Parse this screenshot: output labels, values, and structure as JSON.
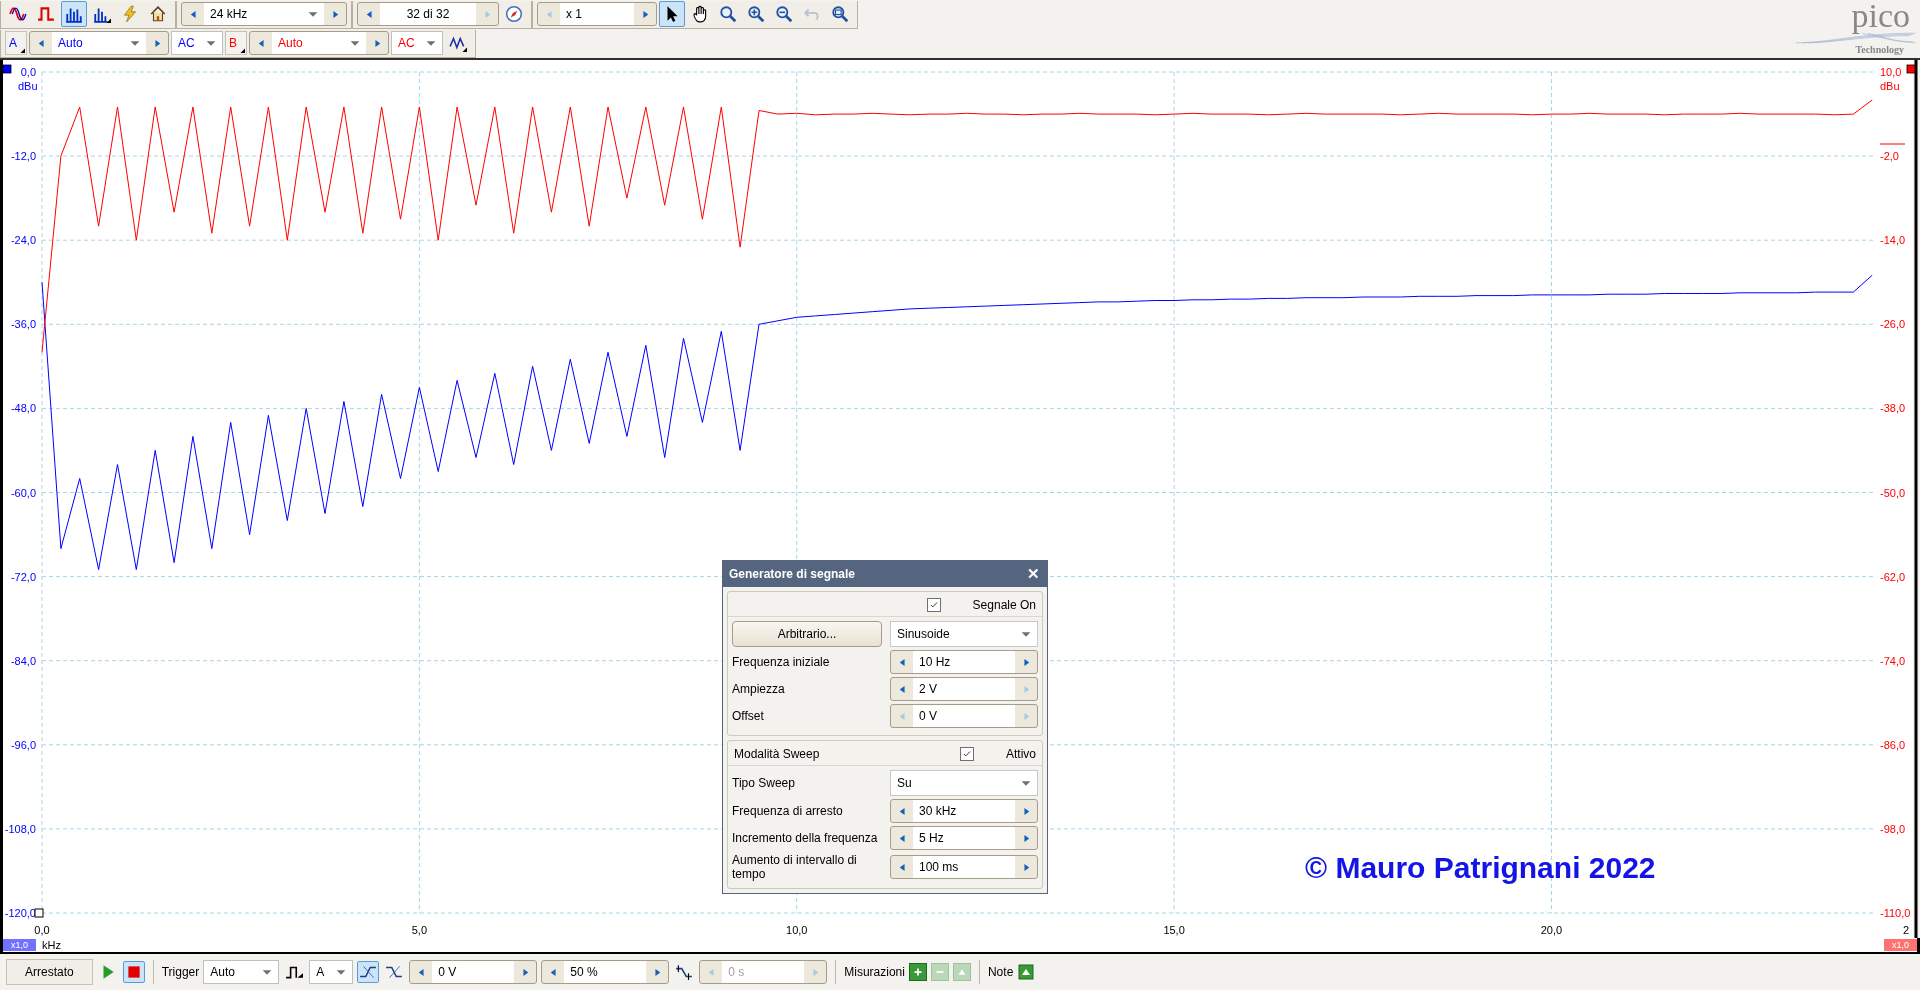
{
  "toolbar": {
    "view_modes": [
      {
        "selected": false
      },
      {
        "selected": false
      },
      {
        "selected": true
      },
      {
        "selected": false
      }
    ],
    "frequency_range": {
      "value": "24 kHz",
      "prev_disabled": false,
      "next_disabled": false
    },
    "capture": {
      "value": "32 di 32",
      "prev_disabled": false,
      "next_disabled": true
    },
    "zoom": {
      "value": "x 1",
      "prev_disabled": true,
      "next_disabled": false
    },
    "tools": [
      {
        "selected": true
      },
      {
        "selected": false
      },
      {
        "selected": false
      },
      {
        "selected": false
      },
      {
        "selected": false
      }
    ],
    "undo_disabled": true
  },
  "channels": [
    {
      "name": "A",
      "color": "#0000ff",
      "range": "Auto",
      "coupling": "AC",
      "prev_disabled": false,
      "next_disabled": false
    },
    {
      "name": "B",
      "color": "#ff0000",
      "range": "Auto",
      "coupling": "AC",
      "prev_disabled": false,
      "next_disabled": false
    }
  ],
  "logo": {
    "name": "pico",
    "tagline": "Technology"
  },
  "plot": {
    "chart_data": {
      "type": "line",
      "grid": true,
      "xlabel": "kHz",
      "ylabel": "dBu",
      "y2label": "dBu",
      "x": [
        0,
        0.25,
        0.5,
        0.75,
        1,
        1.25,
        1.5,
        1.75,
        2,
        2.25,
        2.5,
        2.75,
        3,
        3.25,
        3.5,
        3.75,
        4,
        4.25,
        4.5,
        4.75,
        5,
        5.25,
        5.5,
        5.75,
        6,
        6.25,
        6.5,
        6.75,
        7,
        7.25,
        7.5,
        7.75,
        8,
        8.25,
        8.5,
        8.75,
        9,
        9.25,
        9.5,
        9.75,
        10,
        10.25,
        10.5,
        10.75,
        11,
        11.25,
        11.5,
        11.75,
        12,
        12.25,
        12.5,
        12.75,
        13,
        13.25,
        13.5,
        13.75,
        14,
        14.25,
        14.5,
        14.75,
        15,
        15.25,
        15.5,
        15.75,
        16,
        16.25,
        16.5,
        16.75,
        17,
        17.25,
        17.5,
        17.75,
        18,
        18.25,
        18.5,
        18.75,
        19,
        19.25,
        19.5,
        19.75,
        20,
        20.25,
        20.5,
        20.75,
        21,
        21.25,
        21.5,
        21.75,
        22,
        22.25,
        22.5,
        22.75,
        23,
        23.25,
        23.5,
        23.75,
        24,
        24.25
      ],
      "xlim": [
        0,
        24.3
      ],
      "ylim": [
        -120,
        0
      ],
      "y2lim": [
        -110,
        10
      ],
      "xticks": [
        {
          "value": 0,
          "label": "0,0"
        },
        {
          "value": 5,
          "label": "5,0"
        },
        {
          "value": 10,
          "label": "10,0"
        },
        {
          "value": 15,
          "label": "15,0"
        },
        {
          "value": 20,
          "label": "20,0"
        }
      ],
      "yticks": [
        {
          "value": 0,
          "label": "0,0"
        },
        {
          "value": -12,
          "label": "-12,0"
        },
        {
          "value": -24,
          "label": "-24,0"
        },
        {
          "value": -36,
          "label": "-36,0"
        },
        {
          "value": -48,
          "label": "-48,0"
        },
        {
          "value": -60,
          "label": "-60,0"
        },
        {
          "value": -72,
          "label": "-72,0"
        },
        {
          "value": -84,
          "label": "-84,0"
        },
        {
          "value": -96,
          "label": "-96,0"
        },
        {
          "value": -108,
          "label": "-108,0"
        },
        {
          "value": -120,
          "label": "-120,0"
        }
      ],
      "y2ticks": [
        {
          "value": 10,
          "label": "10,0"
        },
        {
          "value": -2,
          "label": "-2,0"
        },
        {
          "value": -14,
          "label": "-14,0"
        },
        {
          "value": -26,
          "label": "-26,0"
        },
        {
          "value": -38,
          "label": "-38,0"
        },
        {
          "value": -50,
          "label": "-50,0"
        },
        {
          "value": -62,
          "label": "-62,0"
        },
        {
          "value": -74,
          "label": "-74,0"
        },
        {
          "value": -86,
          "label": "-86,0"
        },
        {
          "value": -98,
          "label": "-98,0"
        },
        {
          "value": -110,
          "label": "-110,0"
        }
      ],
      "series": [
        {
          "color": "#0000ff",
          "values": [
            -30,
            -68,
            -58,
            -71,
            -56,
            -71,
            -54,
            -70,
            -52,
            -68,
            -50,
            -66,
            -49,
            -64,
            -48,
            -63,
            -47,
            -62,
            -46,
            -58,
            -45,
            -57,
            -44,
            -55,
            -43,
            -56,
            -42,
            -54,
            -41,
            -53,
            -40,
            -52,
            -39,
            -55,
            -38,
            -50,
            -37,
            -54,
            -36,
            -35.5,
            -35,
            -34.8,
            -34.6,
            -34.4,
            -34.2,
            -34,
            -33.8,
            -33.7,
            -33.6,
            -33.5,
            -33.4,
            -33.3,
            -33.2,
            -33.1,
            -33,
            -32.9,
            -32.8,
            -32.8,
            -32.7,
            -32.6,
            -32.6,
            -32.5,
            -32.5,
            -32.4,
            -32.4,
            -32.3,
            -32.3,
            -32.2,
            -32.2,
            -32.2,
            -32.1,
            -32.1,
            -32.1,
            -32,
            -32,
            -32,
            -31.9,
            -31.9,
            -31.9,
            -31.8,
            -31.8,
            -31.8,
            -31.8,
            -31.7,
            -31.7,
            -31.7,
            -31.6,
            -31.6,
            -31.6,
            -31.6,
            -31.5,
            -31.5,
            -31.5,
            -31.5,
            -31.4,
            -31.4,
            -31.4,
            -29
          ]
        },
        {
          "color": "#ff0000",
          "axis": "y2",
          "values": [
            -30,
            -2,
            5,
            -12,
            5,
            -14,
            5,
            -10,
            5,
            -13,
            5,
            -12,
            5,
            -14,
            5,
            -10,
            5,
            -13,
            5,
            -11,
            5,
            -14,
            5,
            -9,
            5,
            -13,
            5,
            -10,
            5,
            -12,
            5,
            -8,
            5,
            -9,
            5,
            -11,
            5,
            -15,
            4.5,
            4,
            4.1,
            3.9,
            4,
            4,
            4.1,
            4,
            3.9,
            4,
            4,
            4.1,
            4,
            4,
            3.9,
            4,
            4,
            4.1,
            4,
            4,
            4,
            3.9,
            4,
            4.1,
            4,
            4,
            4,
            3.9,
            4,
            4.1,
            4,
            4,
            4,
            4,
            3.9,
            4,
            4.1,
            4,
            4,
            4,
            4,
            3.9,
            4,
            4,
            4.1,
            4,
            4,
            4,
            3.9,
            4,
            4,
            4,
            4.1,
            4,
            4,
            4,
            4,
            3.9,
            4,
            6
          ]
        }
      ]
    },
    "edge_label": "2",
    "x_scale_left": "x1,0",
    "x_scale_right": "x1,0"
  },
  "copyright": "© Mauro Patrignani 2022",
  "signal_generator": {
    "title": "Generatore di segnale",
    "close": "✕",
    "signal_on": {
      "label": "Segnale On",
      "checked": true
    },
    "arbitrary_button": "Arbitrario...",
    "waveform": "Sinusoide",
    "params": [
      {
        "label": "Frequenza iniziale",
        "value": "10 Hz",
        "prev_disabled": false,
        "next_disabled": false
      },
      {
        "label": "Ampiezza",
        "value": "2 V",
        "prev_disabled": false,
        "next_disabled": true
      },
      {
        "label": "Offset",
        "value": "0 V",
        "prev_disabled": true,
        "next_disabled": true
      }
    ],
    "sweep": {
      "label": "Modalità Sweep",
      "active": {
        "label": "Attivo",
        "checked": true
      },
      "type_label": "Tipo Sweep",
      "type": "Su",
      "params": [
        {
          "label": "Frequenza di arresto",
          "value": "30 kHz",
          "prev_disabled": false,
          "next_disabled": false
        },
        {
          "label": "Incremento della frequenza",
          "value": "5 Hz",
          "prev_disabled": false,
          "next_disabled": false
        },
        {
          "label": "Aumento di intervallo di tempo",
          "value": "100 ms",
          "prev_disabled": false,
          "next_disabled": false
        }
      ]
    }
  },
  "status_bar": {
    "state": "Arrestato",
    "running": false,
    "trigger_label": "Trigger",
    "trigger_mode": "Auto",
    "trigger_channel": "A",
    "edges": [
      {
        "selected": true
      },
      {
        "selected": false
      }
    ],
    "threshold": {
      "value": "0 V",
      "prev_disabled": false,
      "next_disabled": false
    },
    "pretrigger": {
      "value": "50 %",
      "prev_disabled": false,
      "next_disabled": false
    },
    "delay": {
      "value": "0 s",
      "prev_disabled": true,
      "next_disabled": true
    },
    "measurements_label": "Misurazioni",
    "measurement_buttons": [
      {
        "disabled": false
      },
      {
        "disabled": true
      },
      {
        "disabled": true
      }
    ],
    "notes_label": "Note"
  }
}
